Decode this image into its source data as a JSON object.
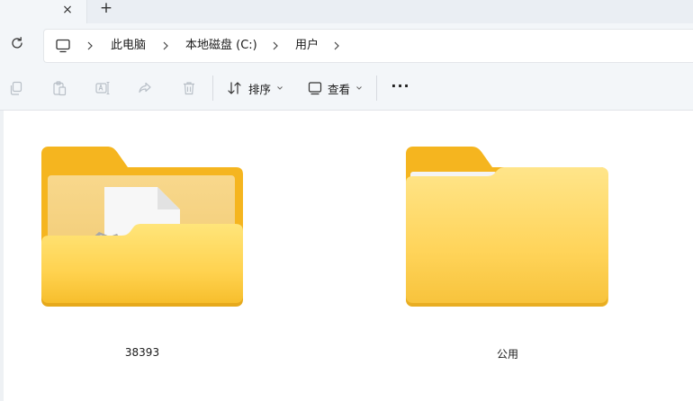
{
  "tabs": {
    "close_glyph": "×",
    "new_tab_glyph": "+"
  },
  "breadcrumb": {
    "items": [
      "此电脑",
      "本地磁盘 (C:)",
      "用户"
    ]
  },
  "toolbar": {
    "sort_label": "排序",
    "view_label": "查看",
    "more_label": "···",
    "icons": [
      "copy-icon",
      "paste-icon",
      "rename-icon",
      "share-icon",
      "delete-icon"
    ]
  },
  "folders": [
    {
      "name": "38393",
      "icon": "folder-with-file-icon"
    },
    {
      "name": "公用",
      "icon": "folder-icon"
    }
  ],
  "colors": {
    "chrome": "#f3f6f9",
    "folder_back": "#f5b51f",
    "folder_front": "#ffd85a"
  }
}
